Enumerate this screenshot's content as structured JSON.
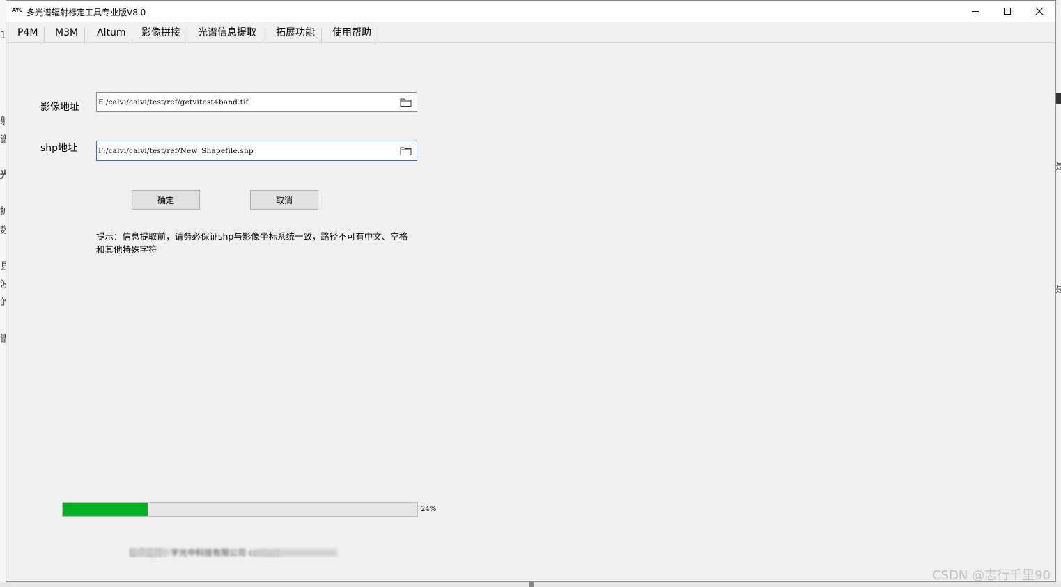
{
  "window": {
    "title": "多光谱辐射标定工具专业版V8.0",
    "icon_text": "AYC"
  },
  "menu": [
    "P4M",
    "M3M",
    "Altum",
    "影像拼接",
    "光谱信息提取",
    "拓展功能",
    "使用帮助"
  ],
  "form": {
    "image_label": "影像地址",
    "image_path": "F:/calvi/calvi/test/ref/getvitest4band.tif",
    "shp_label": "shp地址",
    "shp_path": "F:/calvi/calvi/test/ref/New_Shapefile.shp",
    "confirm_label": "确定",
    "cancel_label": "取消",
    "hint_line1": "提示：信息提取前，请务必保证shp与影像坐标系统一致，路径不可有中文、空格",
    "hint_line2": "和其他特殊字符"
  },
  "progress": {
    "value": 24,
    "label": "24%",
    "color": "#06b025"
  },
  "footer_text": "技术支持：宇光中科技有限公司 contact",
  "watermark": "CSDN @志行千里90",
  "background_app": {
    "left_chars": [
      "1",
      "射",
      "谱",
      "光",
      "扩",
      "数",
      "县",
      "波",
      "的",
      "谱"
    ],
    "right_chars": [
      "是",
      "是"
    ]
  },
  "icons": {
    "minimize": "minimize-icon",
    "maximize": "maximize-icon",
    "close": "close-icon",
    "folder": "folder-icon"
  }
}
